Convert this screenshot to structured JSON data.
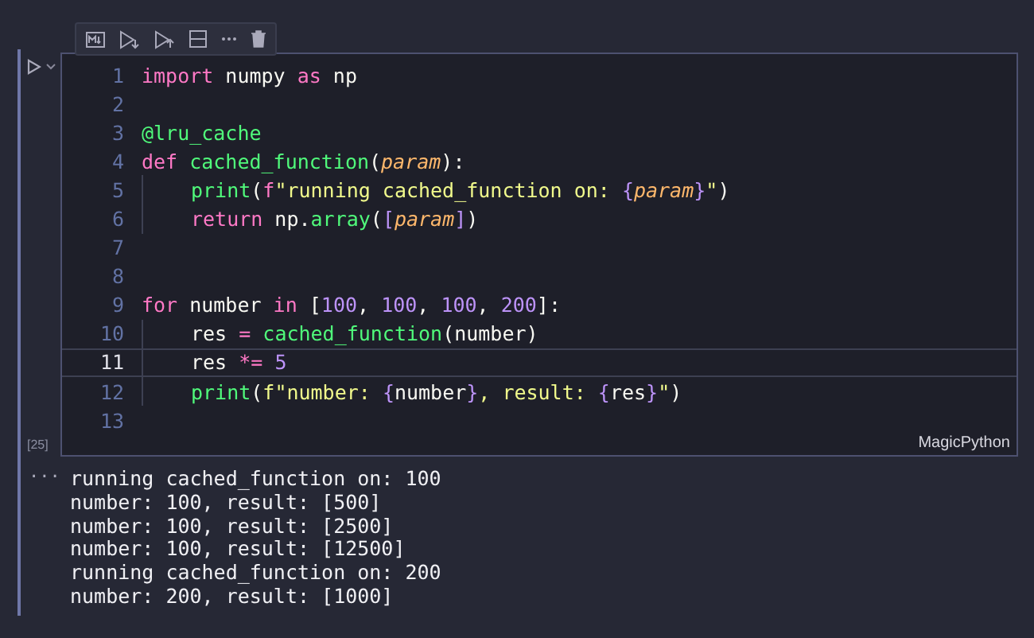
{
  "cell": {
    "execution_count": "[25]",
    "language": "MagicPython",
    "lines": [
      {
        "number": "1",
        "selected": false,
        "indented": false,
        "tokens": [
          {
            "text": "import",
            "kind": "keyword"
          },
          {
            "text": " numpy ",
            "kind": "plain"
          },
          {
            "text": "as",
            "kind": "keyword"
          },
          {
            "text": " np",
            "kind": "plain"
          }
        ]
      },
      {
        "number": "2",
        "selected": false,
        "indented": false
      },
      {
        "number": "3",
        "selected": false,
        "indented": false,
        "tokens": [
          {
            "text": "@lru_cache",
            "kind": "function"
          }
        ]
      },
      {
        "number": "4",
        "selected": false,
        "indented": false,
        "tokens": [
          {
            "text": "def ",
            "kind": "keyword"
          },
          {
            "text": "cached_function",
            "kind": "function"
          },
          {
            "text": "(",
            "kind": "plain"
          },
          {
            "text": "param",
            "kind": "param"
          },
          {
            "text": "):",
            "kind": "plain"
          }
        ]
      },
      {
        "number": "5",
        "selected": false,
        "indented": true,
        "tokens": [
          {
            "text": "print",
            "kind": "function"
          },
          {
            "text": "(",
            "kind": "plain"
          },
          {
            "text": "f",
            "kind": "keyword"
          },
          {
            "text": "\"running cached_function on: ",
            "kind": "string"
          },
          {
            "text": "{",
            "kind": "number"
          },
          {
            "text": "param",
            "kind": "param"
          },
          {
            "text": "}",
            "kind": "number"
          },
          {
            "text": "\"",
            "kind": "string"
          },
          {
            "text": ")",
            "kind": "plain"
          }
        ]
      },
      {
        "number": "6",
        "selected": false,
        "indented": true,
        "tokens": [
          {
            "text": "return",
            "kind": "keyword"
          },
          {
            "text": " np.",
            "kind": "plain"
          },
          {
            "text": "array",
            "kind": "function"
          },
          {
            "text": "(",
            "kind": "plain"
          },
          {
            "text": "[",
            "kind": "number"
          },
          {
            "text": "param",
            "kind": "param"
          },
          {
            "text": "]",
            "kind": "number"
          },
          {
            "text": ")",
            "kind": "plain"
          }
        ]
      },
      {
        "number": "7",
        "selected": false,
        "indented": false
      },
      {
        "number": "8",
        "selected": false,
        "indented": false
      },
      {
        "number": "9",
        "selected": false,
        "indented": false,
        "tokens": [
          {
            "text": "for",
            "kind": "keyword"
          },
          {
            "text": " number ",
            "kind": "plain"
          },
          {
            "text": "in",
            "kind": "keyword"
          },
          {
            "text": " [",
            "kind": "plain"
          },
          {
            "text": "100",
            "kind": "number"
          },
          {
            "text": ", ",
            "kind": "plain"
          },
          {
            "text": "100",
            "kind": "number"
          },
          {
            "text": ", ",
            "kind": "plain"
          },
          {
            "text": "100",
            "kind": "number"
          },
          {
            "text": ", ",
            "kind": "plain"
          },
          {
            "text": "200",
            "kind": "number"
          },
          {
            "text": "]:",
            "kind": "plain"
          }
        ]
      },
      {
        "number": "10",
        "selected": false,
        "indented": true,
        "tokens": [
          {
            "text": "res ",
            "kind": "plain"
          },
          {
            "text": "= ",
            "kind": "keyword"
          },
          {
            "text": "cached_function",
            "kind": "function"
          },
          {
            "text": "(number)",
            "kind": "plain"
          }
        ]
      },
      {
        "number": "11",
        "selected": true,
        "indented": true,
        "tokens": [
          {
            "text": "res ",
            "kind": "plain"
          },
          {
            "text": "*= ",
            "kind": "keyword"
          },
          {
            "text": "5",
            "kind": "number"
          }
        ]
      },
      {
        "number": "12",
        "selected": false,
        "indented": true,
        "tokens": [
          {
            "text": "print",
            "kind": "function"
          },
          {
            "text": "(",
            "kind": "plain"
          },
          {
            "text": "f\"number: ",
            "kind": "string"
          },
          {
            "text": "{",
            "kind": "number"
          },
          {
            "text": "number",
            "kind": "plain"
          },
          {
            "text": "}",
            "kind": "number"
          },
          {
            "text": ", result: ",
            "kind": "string"
          },
          {
            "text": "{",
            "kind": "number"
          },
          {
            "text": "res",
            "kind": "plain"
          },
          {
            "text": "}",
            "kind": "number"
          },
          {
            "text": "\"",
            "kind": "string"
          },
          {
            "text": ")",
            "kind": "plain"
          }
        ]
      },
      {
        "number": "13",
        "selected": false,
        "indented": false
      }
    ]
  },
  "output": {
    "menu": "···",
    "lines": [
      "running cached_function on: 100",
      "number: 100, result: [500]",
      "number: 100, result: [2500]",
      "number: 100, result: [12500]",
      "running cached_function on: 200",
      "number: 200, result: [1000]"
    ]
  }
}
